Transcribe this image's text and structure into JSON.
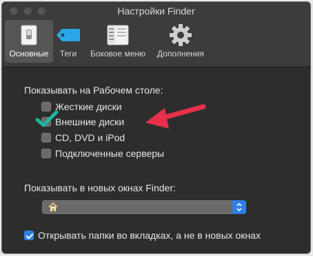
{
  "window": {
    "title": "Настройки Finder"
  },
  "toolbar": {
    "tabs": [
      {
        "label": "Основные",
        "icon": "general-switch-icon",
        "active": true
      },
      {
        "label": "Теги",
        "icon": "tag-icon",
        "active": false
      },
      {
        "label": "Боковое меню",
        "icon": "sidebar-icon",
        "active": false
      },
      {
        "label": "Дополнения",
        "icon": "gear-icon",
        "active": false
      }
    ]
  },
  "desktop_section": {
    "label": "Показывать на Рабочем столе:",
    "items": [
      {
        "label": "Жесткие диски",
        "checked": false
      },
      {
        "label": "Внешние диски",
        "checked": true
      },
      {
        "label": "CD, DVD и iPod",
        "checked": false
      },
      {
        "label": "Подключенные серверы",
        "checked": false
      }
    ]
  },
  "new_window_section": {
    "label": "Показывать в новых окнах Finder:",
    "selected_value": "",
    "selected_icon": "home-icon"
  },
  "open_in_tabs": {
    "label": "Открывать папки во вкладках, а не в новых окнах",
    "checked": true
  },
  "colors": {
    "accent": "#2f7fe6",
    "annotation_arrow": "#e8304a",
    "annotation_check": "#1fb5a2"
  }
}
